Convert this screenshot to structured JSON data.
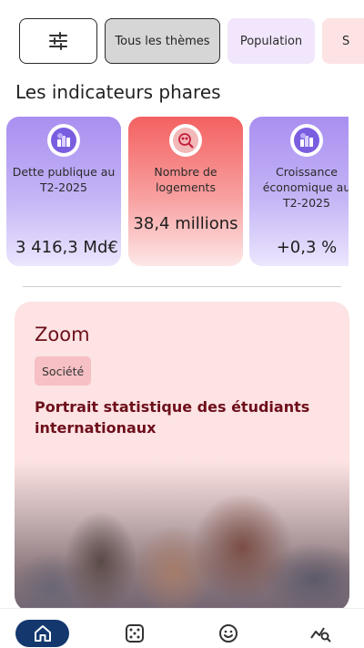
{
  "chips": [
    {
      "label": ""
    },
    {
      "label": "Tous les thèmes"
    },
    {
      "label": "Population"
    },
    {
      "label": "S"
    }
  ],
  "section": {
    "title": "Les indicateurs phares"
  },
  "indicators": [
    {
      "label": "Dette publique au T2-2025",
      "value": "3 416,3 Md€",
      "icon": "building-chart-icon"
    },
    {
      "label": "Nombre de logements",
      "value": "38,4 millions",
      "icon": "people-search-icon"
    },
    {
      "label": "Croissance économique au T2-2025",
      "value": "+0,3 %",
      "icon": "building-chart-icon"
    }
  ],
  "zoom": {
    "title": "Zoom",
    "tag": "Société",
    "article_title": "Portrait statistique des étudiants internationaux"
  },
  "nav": [
    {
      "icon": "home-icon"
    },
    {
      "icon": "dice-icon"
    },
    {
      "icon": "smiley-icon"
    },
    {
      "icon": "trend-search-icon"
    }
  ],
  "colors": {
    "primary": "#14386e",
    "zoom_title": "#6d0f1b",
    "zoom_bg": "#fde3e3",
    "card_purple": "#a98ff0",
    "card_red": "#f46161"
  }
}
